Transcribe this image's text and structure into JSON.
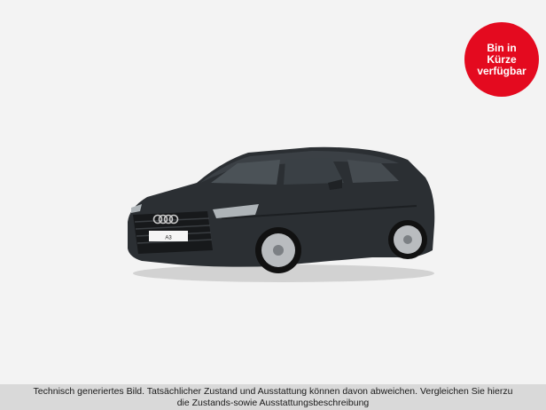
{
  "badge": {
    "line1": "Bin in",
    "line2": "Kürze",
    "line3": "verfügbar",
    "color": "#e40a1f"
  },
  "car": {
    "plate": "A3",
    "color": "#2b2f33"
  },
  "disclaimer": {
    "line1": "Technisch generiertes Bild. Tatsächlicher Zustand und Ausstattung können davon abweichen. Vergleichen Sie hierzu",
    "line2": "die Zustands-sowie Ausstattungsbeschreibung"
  }
}
